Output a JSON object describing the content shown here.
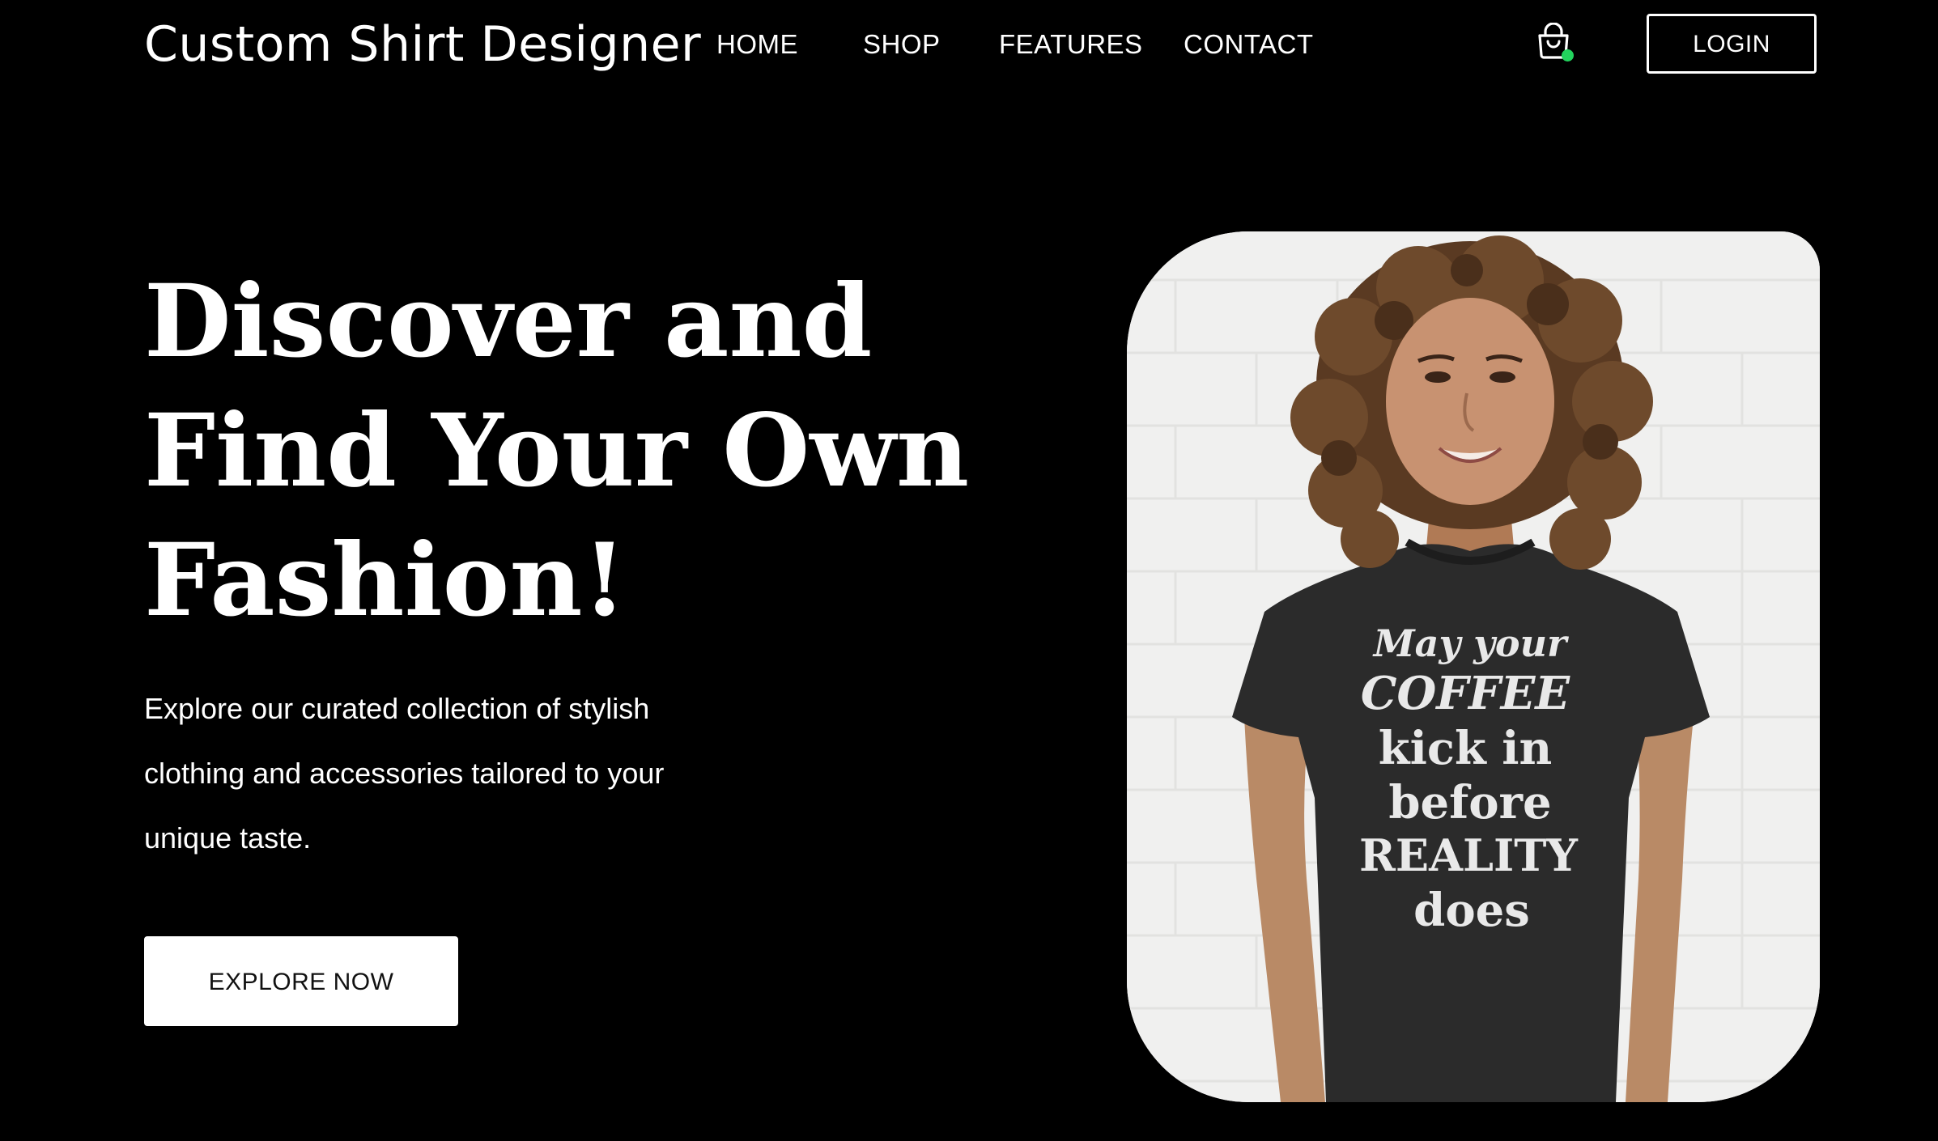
{
  "header": {
    "brand": "Custom Shirt Designer",
    "nav": [
      {
        "label": "HOME"
      },
      {
        "label": "SHOP"
      },
      {
        "label": "FEATURES"
      },
      {
        "label": "CONTACT"
      }
    ],
    "cart_icon": "shopping-bag-icon",
    "cart_badge_color": "#22d35d",
    "login_label": "LOGIN"
  },
  "hero": {
    "headline_lines": [
      "Discover and",
      "Find Your Own",
      "Fashion!"
    ],
    "description_lines": [
      "Explore our curated collection of stylish",
      "clothing and accessories tailored to your",
      "unique taste."
    ],
    "cta_label": "EXPLORE NOW",
    "image": {
      "shirt_text_lines": [
        "May your",
        "COFFEE",
        "kick in",
        "before",
        "REALITY",
        "does"
      ]
    }
  },
  "colors": {
    "background": "#000000",
    "text": "#ffffff",
    "button_background": "#ffffff",
    "button_text": "#111111",
    "shirt": "#2b2b2b"
  }
}
